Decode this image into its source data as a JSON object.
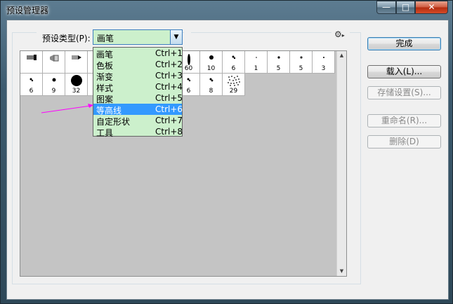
{
  "window": {
    "title": "预设管理器"
  },
  "titlebar_buttons": {
    "minimize": "—",
    "maximize": "□",
    "close": "✕"
  },
  "preset_type": {
    "label": "预设类型(P):",
    "value": "画笔"
  },
  "dropdown": {
    "items": [
      {
        "label": "画笔",
        "shortcut": "Ctrl+1"
      },
      {
        "label": "色板",
        "shortcut": "Ctrl+2"
      },
      {
        "label": "渐变",
        "shortcut": "Ctrl+3"
      },
      {
        "label": "样式",
        "shortcut": "Ctrl+4"
      },
      {
        "label": "图案",
        "shortcut": "Ctrl+5"
      },
      {
        "label": "等高线",
        "shortcut": "Ctrl+6"
      },
      {
        "label": "自定形状",
        "shortcut": "Ctrl+7"
      },
      {
        "label": "工具",
        "shortcut": "Ctrl+8"
      }
    ],
    "highlighted_index": 5
  },
  "brush_tiles": {
    "row1": [
      "",
      "",
      "",
      "60",
      "10",
      "6",
      "1",
      "5",
      "5",
      "3"
    ],
    "row2": [
      "6",
      "9",
      "32",
      "6",
      "8",
      "29"
    ]
  },
  "buttons": {
    "done": "完成",
    "load": "载入(L)...",
    "save_set": "存储设置(S)...",
    "rename": "重命名(R)...",
    "delete": "删除(D)"
  },
  "icons": {
    "gear": "⚙",
    "combo_arrow": "▼",
    "scroll_up": "▲",
    "scroll_down": "▼"
  }
}
